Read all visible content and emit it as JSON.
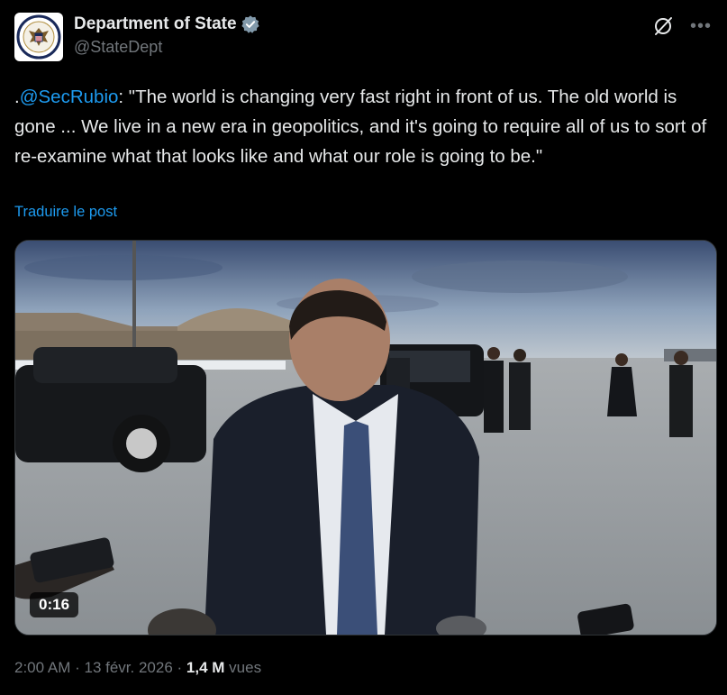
{
  "account": {
    "display_name": "Department of State",
    "handle": "@StateDept",
    "verified": true,
    "verified_color": "#829aab"
  },
  "tweet": {
    "prefix": ".",
    "mention": "@SecRubio",
    "text": ": \"The world is changing very fast right in front of us. The old world is gone ... We live in a new era in geopolitics, and it's going to require all of us to sort of re-examine what that looks like and what our role is going to be.\"",
    "translate_label": "Traduire le post"
  },
  "media": {
    "type": "video",
    "duration": "0:16"
  },
  "meta": {
    "time": "2:00 AM",
    "separator1": " · ",
    "date": "13 févr. 2026",
    "separator2": " · ",
    "views_count": "1,4 M",
    "views_label": " vues"
  },
  "icons": {
    "grok": "grok-icon",
    "more": "more-options-icon"
  },
  "colors": {
    "background": "#000000",
    "text": "#e7e9ea",
    "muted": "#71767b",
    "link": "#1d9bf0"
  }
}
